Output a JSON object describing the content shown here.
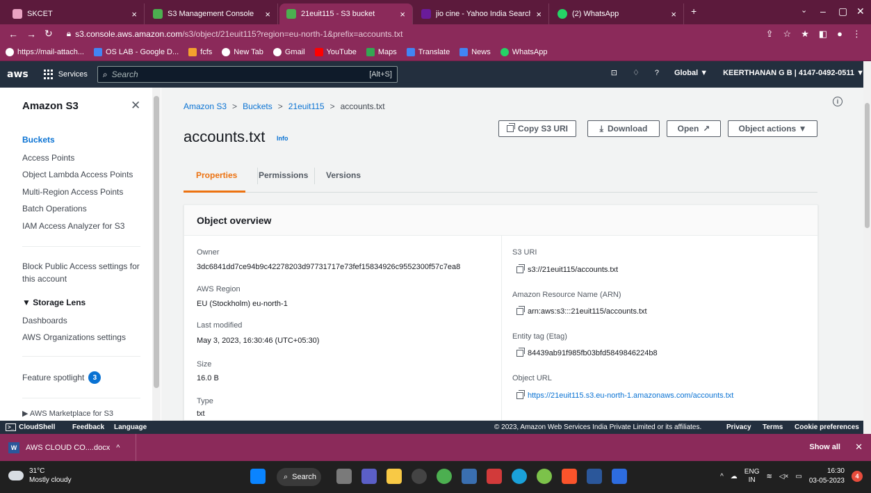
{
  "browser": {
    "tabs": [
      {
        "label": "SKCET",
        "color": "#e9a3c2"
      },
      {
        "label": "S3 Management Console",
        "color": "#4caf50"
      },
      {
        "label": "21euit115 - S3 bucket",
        "color": "#4caf50"
      },
      {
        "label": "jio cine - Yahoo India Search Res",
        "color": "#6a1b9a"
      },
      {
        "label": "(2) WhatsApp",
        "color": "#25d366"
      }
    ],
    "url_host": "s3.console.aws.amazon.com",
    "url_path": "/s3/object/21euit115?region=eu-north-1&prefix=accounts.txt",
    "bookmarks": [
      {
        "label": "https://mail-attach...",
        "color": "#ffffff"
      },
      {
        "label": "OS LAB - Google D...",
        "color": "#4285f4"
      },
      {
        "label": "fcfs",
        "color": "#f4a22d"
      },
      {
        "label": "New Tab",
        "color": "#ffffff"
      },
      {
        "label": "Gmail",
        "color": "#ffffff"
      },
      {
        "label": "YouTube",
        "color": "#ff0000"
      },
      {
        "label": "Maps",
        "color": "#34a853"
      },
      {
        "label": "Translate",
        "color": "#4285f4"
      },
      {
        "label": "News",
        "color": "#4285f4"
      },
      {
        "label": "WhatsApp",
        "color": "#25d366"
      }
    ]
  },
  "aws": {
    "logo": "aws",
    "services": "Services",
    "search_placeholder": "Search",
    "search_shortcut": "[Alt+S]",
    "region": "Global ▼",
    "account": "KEERTHANAN G B | 4147-0492-0511 ▼"
  },
  "sidebar": {
    "title": "Amazon S3",
    "items": [
      "Buckets",
      "Access Points",
      "Object Lambda Access Points",
      "Multi-Region Access Points",
      "Batch Operations",
      "IAM Access Analyzer for S3"
    ],
    "block_public": "Block Public Access settings for",
    "block_public_2": "this account",
    "storage_lens": "▼ Storage Lens",
    "dashboards": "Dashboards",
    "org_settings": "AWS Organizations settings",
    "feature_spotlight": "Feature spotlight",
    "feature_count": "3",
    "marketplace": "▶ AWS Marketplace for S3"
  },
  "main": {
    "breadcrumb": [
      "Amazon S3",
      "Buckets",
      "21euit115",
      "accounts.txt"
    ],
    "title": "accounts.txt",
    "info": "Info",
    "buttons": {
      "copy_uri": "Copy S3 URI",
      "download": "Download",
      "open": "Open",
      "actions": "Object actions ▼"
    },
    "tabs": [
      "Properties",
      "Permissions",
      "Versions"
    ],
    "overview_title": "Object overview",
    "fields": {
      "owner_label": "Owner",
      "owner": "3dc6841dd7ce94b9c42278203d97731717e73fef15834926c9552300f57c7ea8",
      "region_label": "AWS Region",
      "region": "EU (Stockholm) eu-north-1",
      "modified_label": "Last modified",
      "modified": "May 3, 2023, 16:30:46 (UTC+05:30)",
      "size_label": "Size",
      "size": "16.0 B",
      "type_label": "Type",
      "type": "txt",
      "uri_label": "S3 URI",
      "uri": "s3://21euit115/accounts.txt",
      "arn_label": "Amazon Resource Name (ARN)",
      "arn": "arn:aws:s3:::21euit115/accounts.txt",
      "etag_label": "Entity tag (Etag)",
      "etag": "84439ab91f985fb03bfd5849846224b8",
      "url_label": "Object URL",
      "url": "https://21euit115.s3.eu-north-1.amazonaws.com/accounts.txt"
    }
  },
  "footer": {
    "cloudshell": "CloudShell",
    "feedback": "Feedback",
    "language": "Language",
    "copyright": "© 2023, Amazon Web Services India Private Limited or its affiliates.",
    "privacy": "Privacy",
    "terms": "Terms",
    "cookies": "Cookie preferences"
  },
  "download_shelf": {
    "file": "AWS CLOUD CO....docx",
    "show_all": "Show all"
  },
  "taskbar": {
    "temp": "31°C",
    "weather": "Mostly cloudy",
    "search": "Search",
    "lang1": "ENG",
    "lang2": "IN",
    "time": "16:30",
    "date": "03-05-2023",
    "notif": "4"
  }
}
